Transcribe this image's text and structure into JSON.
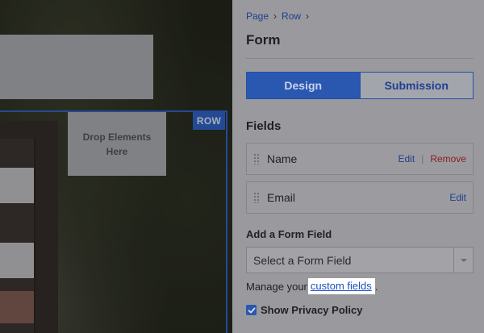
{
  "canvas": {
    "row_tag": "ROW",
    "drop_zone_text": "Drop Elements Here"
  },
  "panel": {
    "breadcrumb": [
      "Page",
      "Row"
    ],
    "title": "Form",
    "tabs": [
      {
        "label": "Design",
        "active": true
      },
      {
        "label": "Submission",
        "active": false
      }
    ],
    "fields_heading": "Fields",
    "fields": [
      {
        "name": "Name",
        "edit": "Edit",
        "remove": "Remove"
      },
      {
        "name": "Email",
        "edit": "Edit"
      }
    ],
    "add_field_heading": "Add a Form Field",
    "select": {
      "value": "Select a Form Field"
    },
    "manage_prefix": "Manage your",
    "manage_link": "custom fields",
    "manage_suffix": ".",
    "privacy_label": "Show Privacy Policy",
    "privacy_checked": true
  },
  "colors": {
    "accent": "#2a57b0",
    "link": "#1d4fbf",
    "remove": "#8a1d1d"
  }
}
